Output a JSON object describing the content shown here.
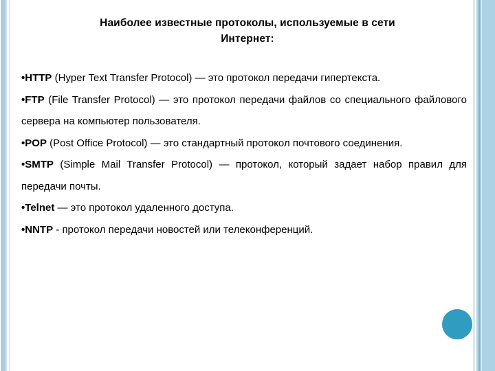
{
  "slide": {
    "title_line1": "Наиболее известные протоколы, используемые в сети",
    "title_line2": "Интернет:",
    "bullet_glyph": "•",
    "items": [
      {
        "name": "HTTP",
        "rest": " (Hyper Text Transfer Protocol) — это протокол передачи гипертекста.",
        "justified": true
      },
      {
        "name": "FTP",
        "rest": " (File Transfer Protocol) — это протокол передачи файлов со специального файлового сервера на компьютер пользователя.",
        "justified": true
      },
      {
        "name": "POP",
        "rest": " (Post Office Protocol) — это стандартный протокол почтового соединения.",
        "justified": true
      },
      {
        "name": "SMTP",
        "rest": " (Simple Mail Transfer Protocol) — протокол, который задает набор правил для передачи почты.",
        "justified": true
      },
      {
        "name": "Telnet",
        "rest": " — это протокол удаленного доступа.",
        "justified": false
      },
      {
        "name": "NNTP",
        "rest": " - протокол передачи новостей или телеконференций.",
        "justified": false
      }
    ]
  },
  "decor": {
    "left_stripe_blue": "#a9cde0",
    "left_stripe_pink": "#f6dfe9",
    "right_band_blue": "#aed2e5",
    "right_rule_dark": "#7fb4cd",
    "circle_color": "#2f9cc0",
    "background": "#ffffff",
    "text_color": "#000000"
  }
}
